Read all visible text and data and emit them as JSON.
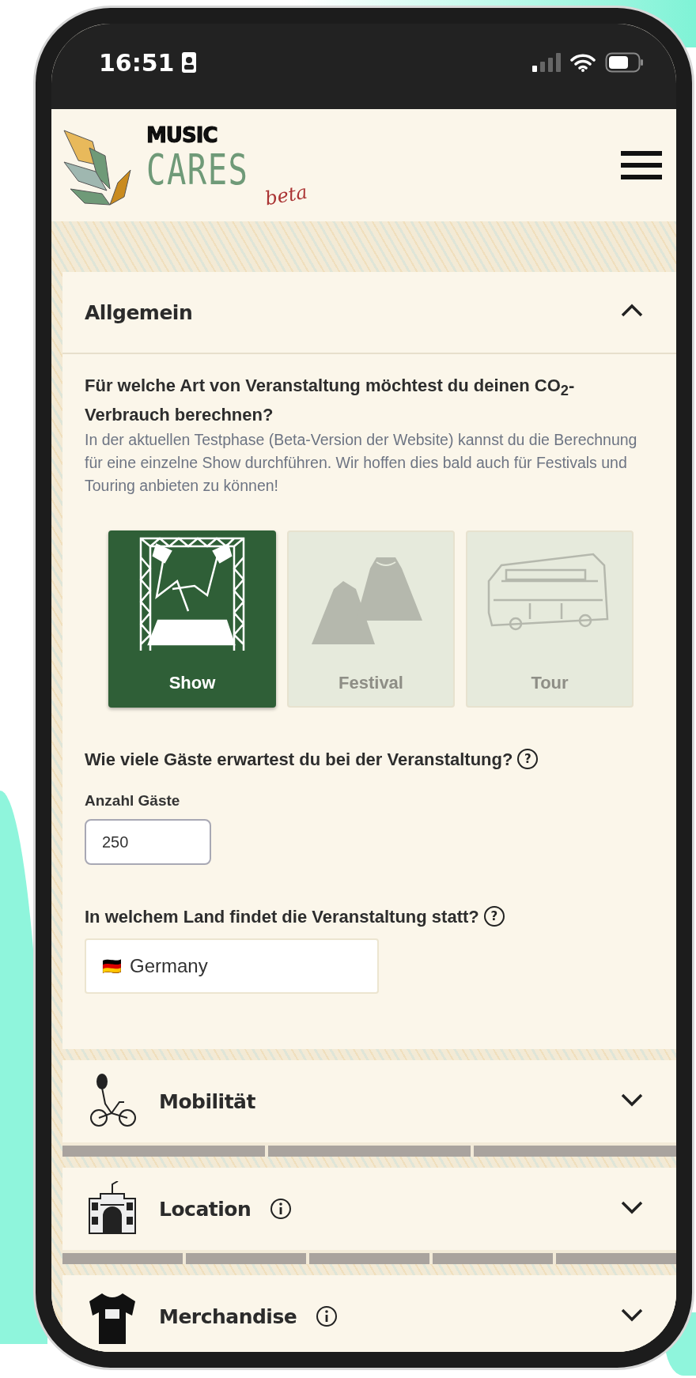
{
  "status_bar": {
    "time": "16:51"
  },
  "logo": {
    "top": "MUSIC",
    "main": "CARES",
    "tag": "beta"
  },
  "sections": [
    {
      "title": "Allgemein",
      "kind": "general",
      "expanded": true,
      "info": false,
      "questions": [
        {
          "kind": "choice",
          "title": "Für welche Art von Veranstaltung möchtest du deinen CO$_{2}$-Verbrauch berechnen?",
          "description": "In der aktuellen Testphase (Beta-Version der Website) kannst du die Berechnung für eine einzelne Show durchführen. Wir hoffen dies bald auch für Festivals und Touring anbieten zu können!",
          "options": [
            {
              "label": "Show",
              "kind": "show",
              "selected": true,
              "disabled": false
            },
            {
              "label": "Festival",
              "kind": "festival",
              "selected": false,
              "disabled": true
            },
            {
              "label": "Tour",
              "kind": "tour",
              "selected": false,
              "disabled": true
            }
          ]
        },
        {
          "kind": "number",
          "title": "Wie viele Gäste erwartest du bei der Veranstaltung?",
          "help": "?",
          "label": "Anzahl Gäste",
          "value": "250"
        },
        {
          "kind": "select",
          "title": "In welchem Land findet die Veranstaltung statt?",
          "help": "?",
          "flag": "🇩🇪",
          "value": "Germany"
        }
      ]
    },
    {
      "title": "Mobilität",
      "kind": "bike",
      "expanded": false,
      "info": false,
      "segments": [
        {
          "done": false
        },
        {
          "done": false
        },
        {
          "done": false
        }
      ]
    },
    {
      "title": "Location",
      "kind": "building",
      "expanded": false,
      "info": true,
      "segments": [
        {
          "done": false
        },
        {
          "done": false
        },
        {
          "done": false
        },
        {
          "done": false
        },
        {
          "done": false
        }
      ]
    },
    {
      "title": "Merchandise",
      "kind": "shirt",
      "expanded": false,
      "info": true
    }
  ]
}
